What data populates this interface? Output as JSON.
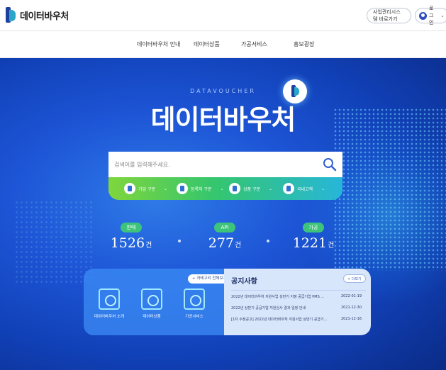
{
  "header": {
    "logo_text": "데이터바우처",
    "mgmt_button": "사업관리시스템 바로가기",
    "login_button": "로그인"
  },
  "nav": {
    "items": [
      "데이터바우처 안내",
      "데이터상품",
      "가공서비스",
      "홍보광장"
    ]
  },
  "hero": {
    "sub_title": "DATAVOUCHER",
    "main_title": "데이터바우처"
  },
  "search": {
    "placeholder": "검색어를 입력해주세요."
  },
  "filters": [
    "기업 구분",
    "등록처 구분",
    "상품 구분",
    "국내고객"
  ],
  "stats": [
    {
      "label": "판매",
      "value": "1526",
      "unit": "건"
    },
    {
      "label": "API",
      "value": "277",
      "unit": "건"
    },
    {
      "label": "가공",
      "value": "1221",
      "unit": "건"
    }
  ],
  "categories": {
    "all_button": "+ 카테고리 전체보기",
    "items": [
      "데이터바우처 소개",
      "데이터상품",
      "가공서비스"
    ]
  },
  "notice": {
    "title": "공지사항",
    "more": "+ 더보기",
    "items": [
      {
        "text": "2022년 데이터바우처 지원사업 상반기 지정 공급기업 PMS ...",
        "date": "2022-01-19"
      },
      {
        "text": "2022년 상반기 공급기업 지원심사 결과 일정 안내",
        "date": "2021-12-30"
      },
      {
        "text": "[1차 수정공고] 2022년 데이터바우처 지원사업 상반기 공급기...",
        "date": "2021-12-16"
      }
    ]
  },
  "colors": {
    "brand_blue": "#1f3f9f",
    "hero_blue": "#1d55d6",
    "accent_green": "#3ec47a",
    "accent_cyan": "#27b6d9"
  },
  "icons": [
    "logo-icon",
    "user-icon",
    "chevron-down-icon",
    "search-icon",
    "building-icon",
    "registry-icon",
    "product-icon",
    "globe-icon"
  ]
}
